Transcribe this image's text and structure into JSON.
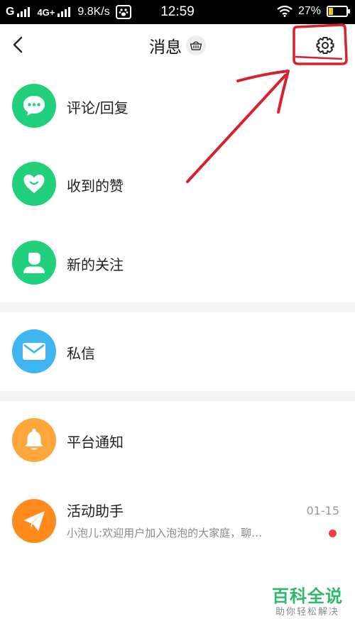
{
  "status_bar": {
    "carrier": "G",
    "network": "4G+",
    "speed": "9.8K/s",
    "time": "12:59",
    "battery": "27%",
    "battery_level": 0.27,
    "icons": [
      "signal-icon",
      "baidu-paw-icon",
      "wifi-icon",
      "battery-icon"
    ]
  },
  "header": {
    "title": "消息",
    "icons": [
      "back-chevron-icon",
      "basket-icon",
      "settings-gear-icon"
    ]
  },
  "colors": {
    "green": "#21d07a",
    "blue": "#3fb6f2",
    "orange": "#ffa63a",
    "orange_deep": "#ff8a1c",
    "annotation_red": "#d8202e",
    "badge_red": "#f2403c",
    "watermark_green": "#2eb86b"
  },
  "sections": [
    {
      "items": [
        {
          "label": "评论/回复",
          "icon": "comment-bubble-icon",
          "color": "#21d07a"
        },
        {
          "label": "收到的赞",
          "icon": "heart-icon",
          "color": "#21d07a"
        },
        {
          "label": "新的关注",
          "icon": "person-icon",
          "color": "#21d07a"
        }
      ]
    },
    {
      "items": [
        {
          "label": "私信",
          "icon": "envelope-icon",
          "color": "#3fb6f2"
        }
      ]
    },
    {
      "items": [
        {
          "label": "平台通知",
          "icon": "bell-icon",
          "color": "#ffa63a"
        },
        {
          "label": "活动助手",
          "icon": "paper-plane-icon",
          "color": "#ff8a1c",
          "subtitle_sender": "小泡儿",
          "subtitle_text": ":欢迎用户加入泡泡的大家庭，聊…",
          "date": "01-15",
          "unread": true
        }
      ]
    }
  ],
  "watermark": {
    "main": "百科全说",
    "sub": "助你轻松解决"
  }
}
